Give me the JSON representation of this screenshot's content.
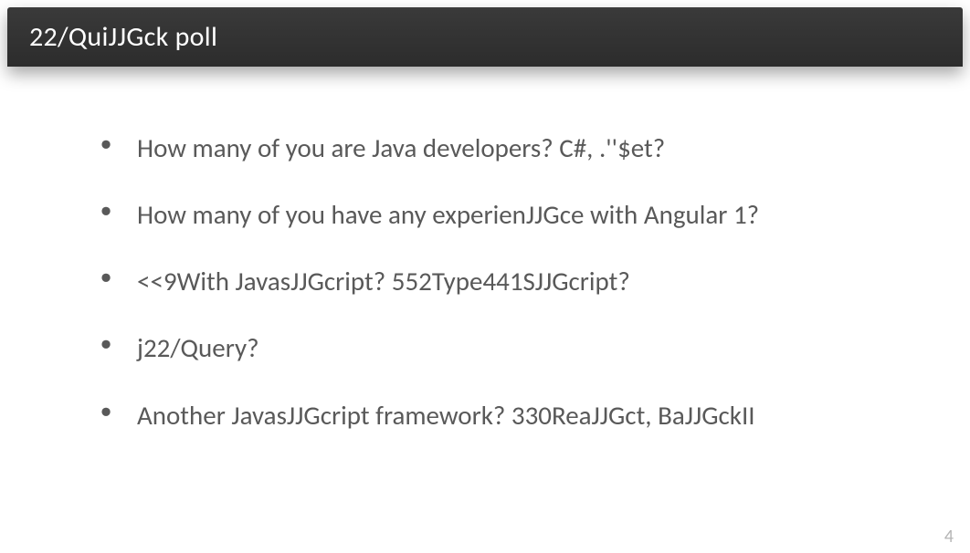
{
  "header": {
    "title": "22/QuiJJGck poll"
  },
  "bullets": {
    "b0": "How many of you are Java developers? C#, .''$et?",
    "b1": "How many of you have any experienJJGce with Angular 1?",
    "b2": "<<9With JavasJJGcript? 552Type441SJJGcript?",
    "b3": "j22/Query?",
    "b4": "Another JavasJJGcript framework? 330ReaJJGct, BaJJGckII"
  },
  "page": {
    "number": "4"
  }
}
